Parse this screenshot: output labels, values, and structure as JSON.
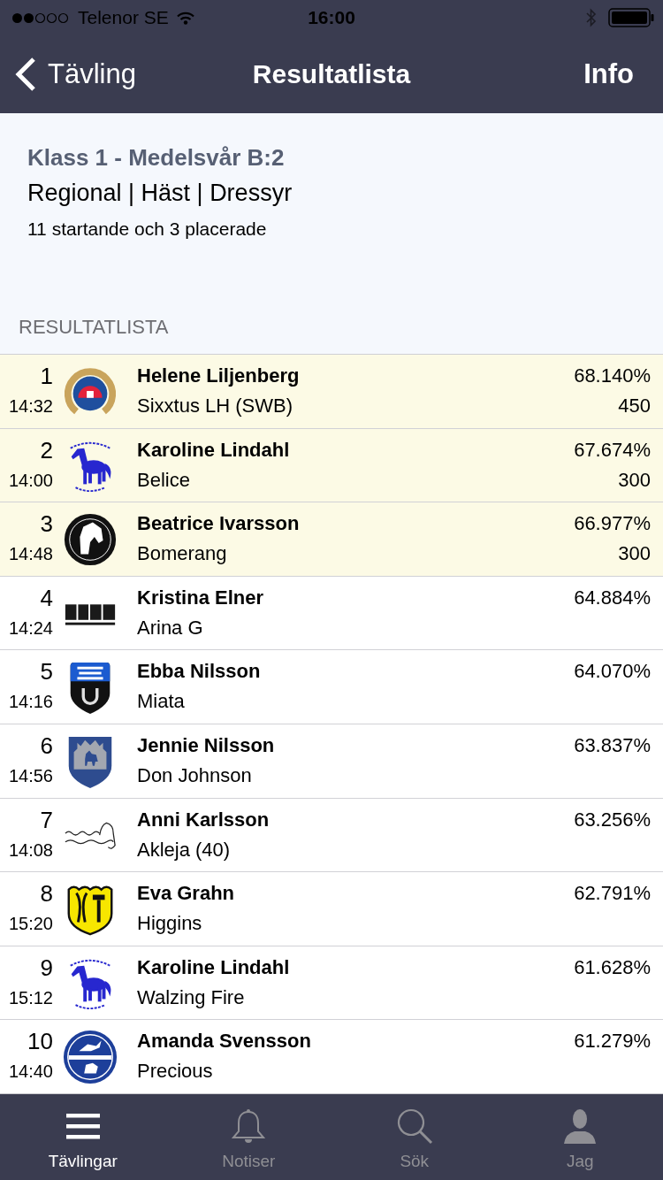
{
  "status_bar": {
    "carrier": "Telenor SE",
    "time": "16:00"
  },
  "nav_bar": {
    "back_label": "Tävling",
    "title": "Resultatlista",
    "action": "Info"
  },
  "class_info": {
    "title": "Klass 1 - Medelsvår B:2",
    "details": "Regional | Häst | Dressyr",
    "summary": "11 startande och 3 placerade"
  },
  "section_header": "RESULTATLISTA",
  "results": [
    {
      "rank": "1",
      "time": "14:32",
      "rider": "Helene Liljenberg",
      "horse": "Sixxtus LH (SWB)",
      "score": "68.140%",
      "points": "450",
      "placed": true
    },
    {
      "rank": "2",
      "time": "14:00",
      "rider": "Karoline Lindahl",
      "horse": "Belice",
      "score": "67.674%",
      "points": "300",
      "placed": true
    },
    {
      "rank": "3",
      "time": "14:48",
      "rider": "Beatrice Ivarsson",
      "horse": "Bomerang",
      "score": "66.977%",
      "points": "300",
      "placed": true
    },
    {
      "rank": "4",
      "time": "14:24",
      "rider": "Kristina Elner",
      "horse": "Arina G",
      "score": "64.884%",
      "placed": false
    },
    {
      "rank": "5",
      "time": "14:16",
      "rider": "Ebba Nilsson",
      "horse": "Miata",
      "score": "64.070%",
      "placed": false
    },
    {
      "rank": "6",
      "time": "14:56",
      "rider": "Jennie Nilsson",
      "horse": "Don Johnson",
      "score": "63.837%",
      "placed": false
    },
    {
      "rank": "7",
      "time": "14:08",
      "rider": "Anni Karlsson",
      "horse": "Akleja (40)",
      "score": "63.256%",
      "placed": false
    },
    {
      "rank": "8",
      "time": "15:20",
      "rider": "Eva Grahn",
      "horse": "Higgins",
      "score": "62.791%",
      "placed": false
    },
    {
      "rank": "9",
      "time": "15:12",
      "rider": "Karoline Lindahl",
      "horse": "Walzing Fire",
      "score": "61.628%",
      "placed": false
    },
    {
      "rank": "10",
      "time": "14:40",
      "rider": "Amanda Svensson",
      "horse": "Precious",
      "score": "61.279%",
      "placed": false
    }
  ],
  "tab_bar": [
    {
      "label": "Tävlingar",
      "selected": true
    },
    {
      "label": "Notiser",
      "selected": false
    },
    {
      "label": "Sök",
      "selected": false
    },
    {
      "label": "Jag",
      "selected": false
    }
  ]
}
